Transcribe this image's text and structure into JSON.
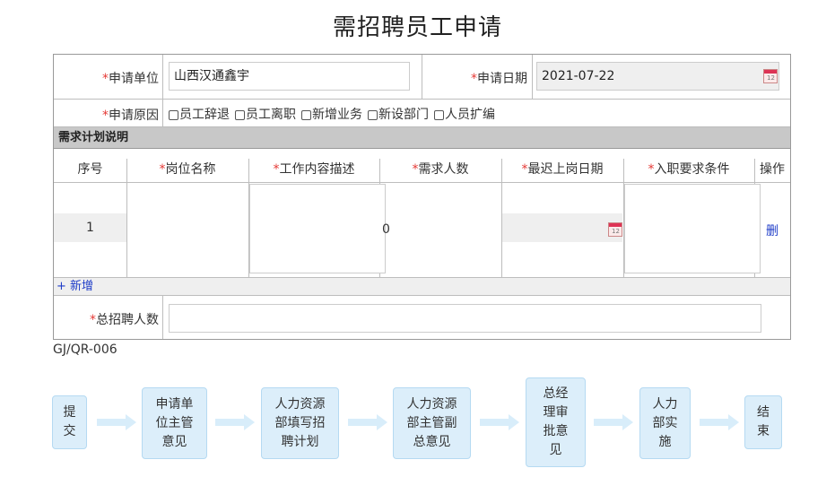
{
  "page": {
    "title": "需招聘员工申请",
    "form_code": "GJ/QR-006"
  },
  "form": {
    "unit_label": "申请单位",
    "unit_value": "山西汉通鑫宇",
    "date_label": "申请日期",
    "date_value": "2021-07-22",
    "reason_label": "申请原因",
    "reasons": [
      "员工辞退",
      "员工离职",
      "新增业务",
      "新设部门",
      "人员扩编"
    ],
    "required_mark": "*",
    "section_title": "需求计划说明",
    "columns": [
      "序号",
      "岗位名称",
      "工作内容描述",
      "需求人数",
      "最迟上岗日期",
      "入职要求条件",
      "操作"
    ],
    "rows": [
      {
        "index": "1",
        "position": "",
        "description": "",
        "count": "0",
        "date": "",
        "requirements": "",
        "action": "删"
      }
    ],
    "add_label": "+ 新增",
    "total_label": "总招聘人数",
    "total_value": "",
    "calendar_icon": "calendar-icon",
    "calendar_day": "12"
  },
  "flow": {
    "steps": [
      "提交",
      "申请单位主管意见",
      "人力资源部填写招聘计划",
      "人力资源部主管副总意见",
      "总经理审批意见",
      "人力部实施",
      "结束"
    ]
  },
  "colors": {
    "required": "#e53935",
    "section_bg": "#c8c8c8",
    "flow_bg": "#dceefa",
    "link": "#1e3cc8"
  }
}
